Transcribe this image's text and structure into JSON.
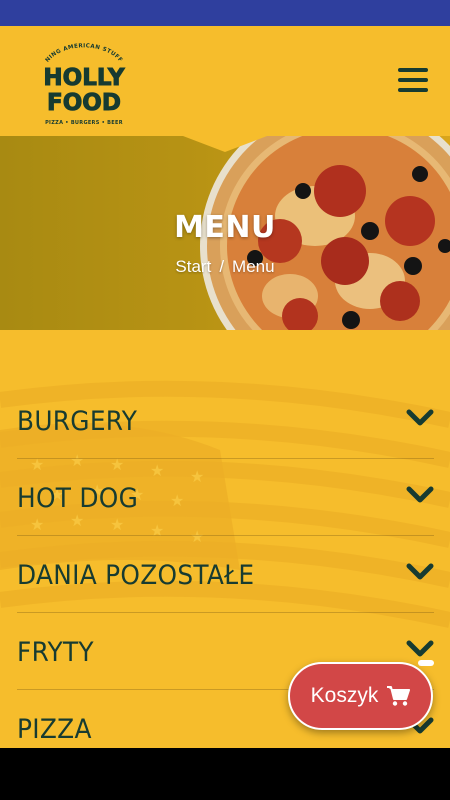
{
  "header": {
    "logo": {
      "top_arc_text": "DINING AMERICAN STUFFIN",
      "line1": "HOLLY",
      "line2": "FOOD",
      "tagline": "PIZZA • BURGERS • BEER"
    },
    "menu_icon": "hamburger-menu-icon"
  },
  "hero": {
    "title": "MENU",
    "breadcrumb": {
      "home": "Start",
      "separator": "/",
      "current": "Menu"
    }
  },
  "menu_categories": [
    {
      "label": "BURGERY"
    },
    {
      "label": "HOT DOG"
    },
    {
      "label": "DANIA POZOSTAŁE"
    },
    {
      "label": "FRYTY"
    },
    {
      "label": "PIZZA"
    }
  ],
  "cart": {
    "label": "Koszyk",
    "icon": "shopping-cart-icon"
  },
  "colors": {
    "status_bar": "#2f3f9e",
    "brand_yellow": "#f6bd2c",
    "brand_green": "#173b31",
    "cart_red": "#d24747"
  }
}
